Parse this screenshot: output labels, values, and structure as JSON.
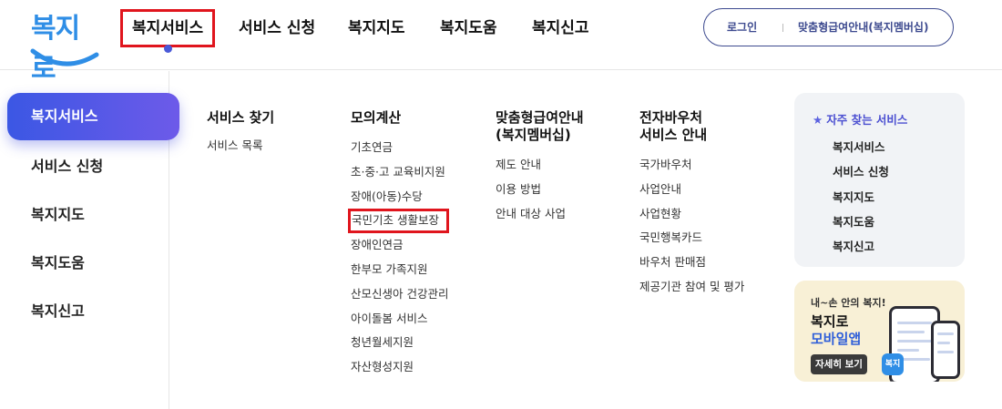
{
  "header": {
    "logo_text": "복지로",
    "nav": [
      {
        "label": "복지서비스",
        "active": true
      },
      {
        "label": "서비스 신청"
      },
      {
        "label": "복지지도"
      },
      {
        "label": "복지도움"
      },
      {
        "label": "복지신고"
      }
    ],
    "login_label": "로그인",
    "guide_label": "맞춤형급여안내(복지멤버십)"
  },
  "sidebar": {
    "items": [
      {
        "label": "복지서비스",
        "active": true
      },
      {
        "label": "서비스 신청"
      },
      {
        "label": "복지지도"
      },
      {
        "label": "복지도움"
      },
      {
        "label": "복지신고"
      }
    ]
  },
  "columns": [
    {
      "title": "서비스 찾기",
      "links": [
        "서비스 목록"
      ]
    },
    {
      "title": "모의계산",
      "links": [
        "기초연금",
        "초·중·고 교육비지원",
        "장애(아동)수당",
        "국민기초 생활보장",
        "장애인연금",
        "한부모 가족지원",
        "산모신생아 건강관리",
        "아이돌봄 서비스",
        "청년월세지원",
        "자산형성지원"
      ]
    },
    {
      "title": "맞춤형급여안내\n(복지멤버십)",
      "links": [
        "제도 안내",
        "이용 방법",
        "안내 대상 사업"
      ]
    },
    {
      "title": "전자바우처\n서비스 안내",
      "links": [
        "국가바우처",
        "사업안내",
        "사업현황",
        "국민행복카드",
        "바우처 판매점",
        "제공기관 참여 및 평가"
      ]
    }
  ],
  "highlighted_link": "국민기초 생활보장",
  "frequent": {
    "title": "자주 찾는 서비스",
    "items": [
      "복지서비스",
      "서비스 신청",
      "복지지도",
      "복지도움",
      "복지신고"
    ]
  },
  "banner": {
    "subtitle": "내~손 안의 복지!",
    "title1": "복지로",
    "title2": "모바일앱",
    "button": "자세히 보기",
    "app_icon_text": "복지로"
  },
  "colors": {
    "accent": "#4b4fd1",
    "highlight_box": "#e0151d",
    "logo": "#2f8ee6"
  }
}
